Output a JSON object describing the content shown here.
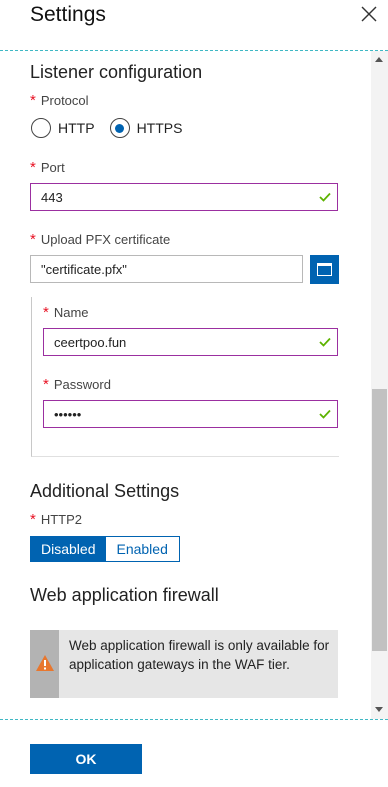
{
  "header": {
    "title": "Settings",
    "close_icon": "close-icon"
  },
  "listener": {
    "heading": "Listener configuration",
    "protocol_label": "Protocol",
    "protocol_options": [
      "HTTP",
      "HTTPS"
    ],
    "protocol_selected": "HTTPS",
    "port_label": "Port",
    "port_value": "443",
    "pfx_label": "Upload PFX certificate",
    "pfx_value": "\"certificate.pfx\"",
    "name_label": "Name",
    "name_value": "ceertpoo.fun",
    "password_label": "Password",
    "password_value": "••••••"
  },
  "additional": {
    "heading": "Additional Settings",
    "http2_label": "HTTP2",
    "http2_options": [
      "Disabled",
      "Enabled"
    ],
    "http2_selected": "Disabled"
  },
  "waf": {
    "heading": "Web application firewall",
    "warning_text": "Web application firewall is only available for application gateways in the WAF tier.",
    "warning_icon": "warning-icon"
  },
  "footer": {
    "ok_label": "OK"
  },
  "colors": {
    "accent": "#0063b1",
    "valid_border": "#9b2fa0",
    "check": "#5db300",
    "required": "#e81123",
    "divider": "#3fb8c4"
  }
}
